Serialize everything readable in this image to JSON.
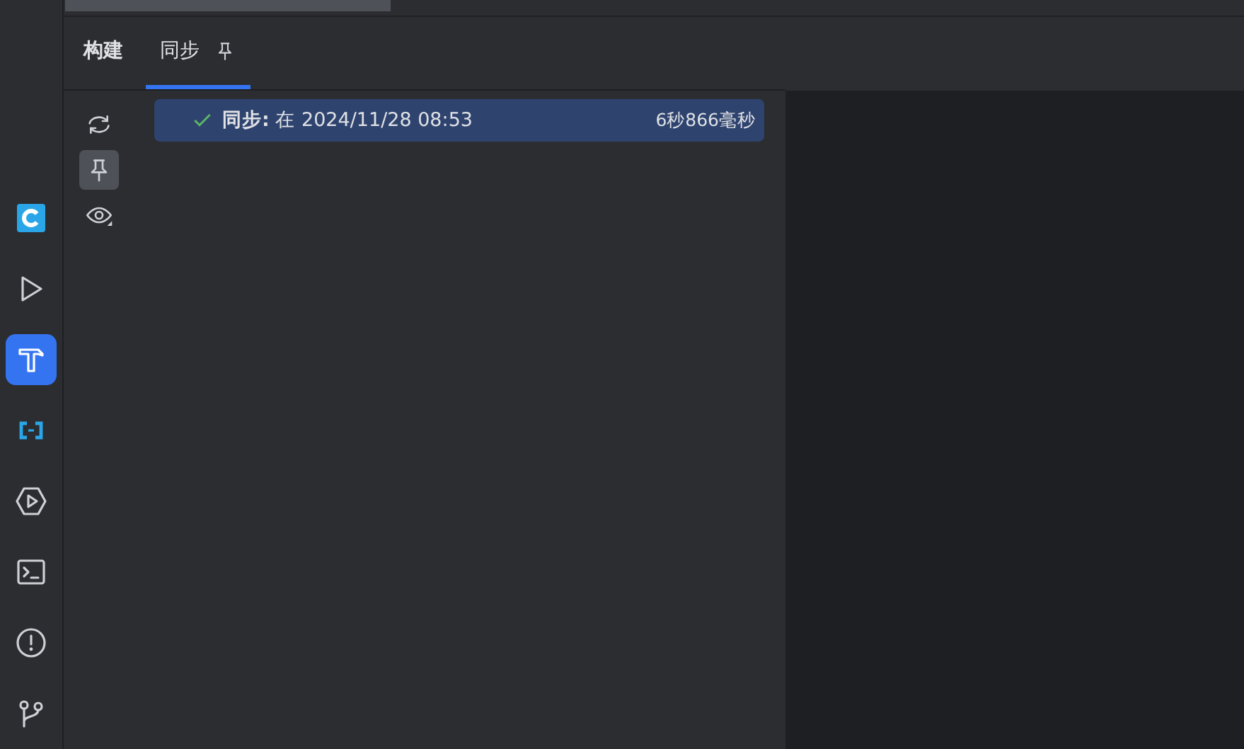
{
  "left_toolbar": [
    {
      "selected": false
    },
    {
      "selected": false
    },
    {
      "selected": true
    },
    {
      "selected": false
    },
    {
      "selected": false
    },
    {
      "selected": false
    },
    {
      "selected": false
    },
    {
      "selected": false
    }
  ],
  "tabs": [
    {
      "label": "构建",
      "selected": false,
      "pinned": false
    },
    {
      "label": "同步",
      "selected": true,
      "pinned": true
    }
  ],
  "tools": [
    {
      "on": false
    },
    {
      "on": true
    },
    {
      "on": false
    }
  ],
  "tree": [
    {
      "kind": "success",
      "selected": true,
      "text": "**同步:** 在 2024/11/28 08:53",
      "duration": "6秒866毫秒"
    }
  ]
}
